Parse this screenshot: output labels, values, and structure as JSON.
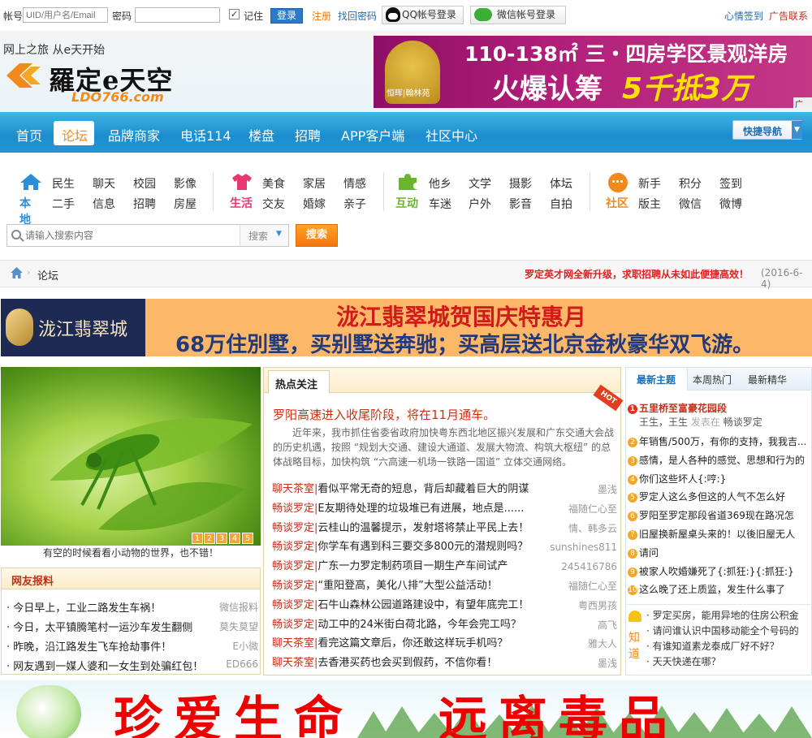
{
  "topbar": {
    "account_label": "帐号",
    "account_placeholder": "UID/用户名/Email",
    "password_label": "密码",
    "remember_label": "记住",
    "login_button": "登录",
    "register_link": "注册",
    "find_password_link": "找回密码",
    "qq_login": "QQ帐号登录",
    "wechat_login": "微信帐号登录",
    "mood_checkin": "心情签到",
    "ad_contact": "广告联系"
  },
  "header": {
    "slogan": "网上之旅 从e天开始",
    "logo_text": "羅定e天空",
    "logo_domain": "LDO766.com",
    "ad_line1": "110-138㎡ 三・四房学区景观洋房",
    "ad_line2_a": "火爆认筹",
    "ad_line2_b": "5千抵3万",
    "ad_brand": "恒晖|翰林苑",
    "ad_tag": "广告"
  },
  "nav": {
    "items": [
      "首页",
      "论坛",
      "品牌商家",
      "电话114",
      "楼盘",
      "招聘",
      "APP客户端",
      "社区中心"
    ],
    "quick_nav": "快捷导航"
  },
  "categories": [
    {
      "title": "本地",
      "color": "#2a8fd8",
      "items": [
        "民生",
        "聊天",
        "校园",
        "影像",
        "二手",
        "信息",
        "招聘",
        "房屋"
      ]
    },
    {
      "title": "生活",
      "color": "#e8386f",
      "items": [
        "美食",
        "家居",
        "情感",
        "交友",
        "婚嫁",
        "亲子"
      ]
    },
    {
      "title": "互动",
      "color": "#6ab52a",
      "items": [
        "他乡",
        "文学",
        "摄影",
        "体坛",
        "车迷",
        "户外",
        "影音",
        "自拍"
      ]
    },
    {
      "title": "社区",
      "color": "#f28a1b",
      "items": [
        "新手",
        "积分",
        "签到",
        "版主",
        "微信",
        "微博"
      ]
    }
  ],
  "search": {
    "placeholder": "请输入搜索内容",
    "type_label": "搜索",
    "button": "搜索"
  },
  "breadcrumb": {
    "current": "论坛",
    "notice": "罗定英才网全新升级，求职招聘从未如此便捷高效！",
    "notice_date": "(2016-6-4)"
  },
  "ad_mid": {
    "logo_text": "泷江翡翠城",
    "line1": "泷江翡翠城贺国庆特惠月",
    "line2": "68万住別墅，买别墅送奔驰；买高层送北京金秋豪华双飞游。"
  },
  "photo": {
    "caption": "有空的时候看看小动物的世界，也不错！",
    "pages": [
      "1",
      "2",
      "3",
      "4",
      "5"
    ]
  },
  "report": {
    "title": "网友报料",
    "items": [
      {
        "text": "今日早上，工业二路发生车祸！",
        "source": "微信报料"
      },
      {
        "text": "今日，太平镇腾笔村一运沙车发生翻侧",
        "source": "莫失莫望"
      },
      {
        "text": "昨晚，沿江路发生飞车抢劫事件！",
        "source": "E小微"
      },
      {
        "text": "网友遇到一媒人婆和一女生到处骗红包！",
        "source": "ED666"
      }
    ]
  },
  "hot": {
    "tab": "热点关注",
    "badge": "HOT",
    "headline": "罗阳高速进入收尾阶段，将在11月通车。",
    "summary": "近年来，我市抓住省委省政府加快粤东西北地区振兴发展和广东交通大会战的历史机遇，按照 “规划大交通、建设大通道、发展大物流、构筑大枢纽” 的总体战略目标，加快构筑 “六高速一机场一铁路一国道” 立体交通网络。",
    "rows": [
      {
        "cat": "聊天茶室|",
        "text": "看似平常无奇的短息，背后却藏着巨大的阴谋",
        "author": "墨浅"
      },
      {
        "cat": "畅谈罗定|",
        "text": "E友期待处理的垃圾堆已有进展，地点是......",
        "author": "福随仁心至"
      },
      {
        "cat": "畅谈罗定|",
        "text": "云桂山的温馨提示，发射塔将禁止平民上去！",
        "author": "情、韩多云"
      },
      {
        "cat": "畅谈罗定|",
        "text": "你学车有遇到科三要交多800元的潜规则吗？",
        "author": "sunshines811"
      },
      {
        "cat": "畅谈罗定|",
        "text": "广东一力罗定制药项目一期生产车间试产",
        "author": "245416786"
      },
      {
        "cat": "畅谈罗定|",
        "text": "“重阳登高，美化八排”大型公益活动！",
        "author": "福随仁心至"
      },
      {
        "cat": "畅谈罗定|",
        "text": "石牛山森林公园道路建设中，有望年底完工！",
        "author": "粤西男孩"
      },
      {
        "cat": "畅谈罗定|",
        "text": "动工中的24米街白荷北路，今年会完工吗？",
        "author": "高飞"
      },
      {
        "cat": "聊天茶室|",
        "text": "看完这篇文章后，你还敢这样玩手机吗？",
        "author": "雅大人"
      },
      {
        "cat": "聊天茶室|",
        "text": "去香港买药也会买到假药，不信你看！",
        "author": "墨浅"
      }
    ]
  },
  "right": {
    "tabs": [
      "最新主题",
      "本周热门",
      "最新精华"
    ],
    "top_title": "五里桥至富豪花园段",
    "top_users": [
      "王生",
      "王生"
    ],
    "top_posted": "发表在",
    "top_forum": "畅谈罗定",
    "items": [
      {
        "num": "2",
        "text": "年销售/500万，有你的支持，我我吉..."
      },
      {
        "num": "3",
        "text": "感情，是人各种的感觉、思想和行为的"
      },
      {
        "num": "4",
        "text": "你们这些坏人{:哼:}"
      },
      {
        "num": "5",
        "text": "罗定人这么多但这的人气不怎么好"
      },
      {
        "num": "6",
        "text": "罗阳至罗定那段省道369现在路况怎"
      },
      {
        "num": "7",
        "text": "旧屋换新屋桌头来的！以後旧屋无人"
      },
      {
        "num": "8",
        "text": "请问"
      },
      {
        "num": "9",
        "text": "被家人吹婚嫌死了{:抓狂:}{:抓狂:}"
      },
      {
        "num": "10",
        "text": "这么晚了还上质监，发生什么事了"
      }
    ],
    "zhidao_label": "知道",
    "zhidao": [
      "罗定买房，能用异地的住房公积金",
      "请问谁认识中国移动能全个号码的",
      "有谁知道素龙泰成厂好不好？",
      "天天快递在哪？"
    ]
  },
  "ad_bottom": {
    "slogan_left": "珍爱生命",
    "slogan_right": "远离毒品"
  },
  "colors": {
    "nav_blue": "#1c8ccd",
    "accent_orange": "#f5760c",
    "link_red": "#c3301a",
    "ad_pink": "#b01e79"
  }
}
